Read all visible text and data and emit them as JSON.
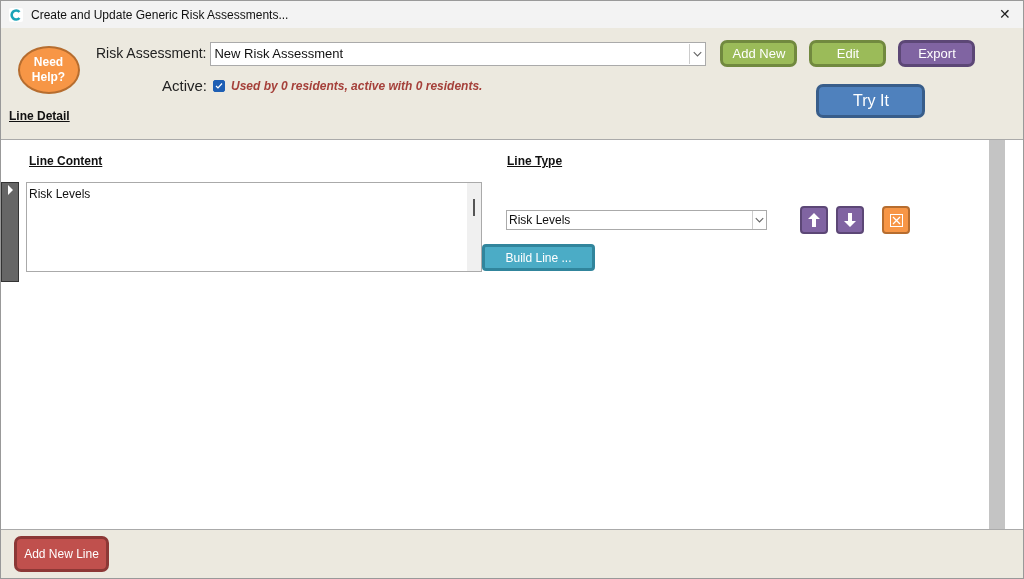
{
  "window": {
    "title": "Create and Update Generic Risk Assessments...",
    "close": "✕"
  },
  "help_button": {
    "label": "Need Help?"
  },
  "risk_assessment": {
    "label": "Risk Assessment:",
    "value": "New Risk Assessment"
  },
  "buttons": [
    {
      "label": "Add New",
      "kind": "green"
    },
    {
      "label": "Edit",
      "kind": "green"
    },
    {
      "label": "Export",
      "kind": "purple"
    }
  ],
  "try_button": {
    "label": "Try It"
  },
  "active": {
    "label": "Active:",
    "checked": true,
    "note": "Used by 0 residents, active with 0 residents."
  },
  "section_title": "Line Detail",
  "columns": {
    "content": "Line Content",
    "type": "Line Type"
  },
  "lines": [
    {
      "content": "Risk Levels",
      "type": "Risk Levels",
      "selected": true,
      "build_label": "Build Line ..."
    }
  ],
  "footer": {
    "add_line": "Add New Line"
  }
}
